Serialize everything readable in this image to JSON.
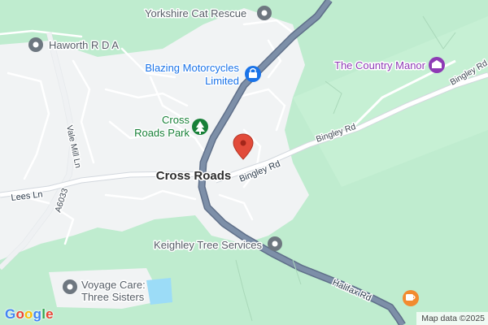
{
  "map": {
    "place_label": "Cross Roads",
    "attribution": "Map data ©2025",
    "logo": "Google",
    "logo_colors": [
      "#4285F4",
      "#EA4335",
      "#FBBC05",
      "#4285F4",
      "#34A853",
      "#EA4335"
    ],
    "colors": {
      "green_area": "#bfeccf",
      "urban_area": "#f1f3f4",
      "main_road": "#7889a4",
      "main_road_outline": "#5f6f89",
      "minor_road": "#ffffff",
      "water": "#9cdcf7",
      "marker": "#e24b3a",
      "poi_gray": "#6e7780",
      "poi_blue": "#1a73e8",
      "poi_green": "#188038",
      "poi_purple": "#8e3bb5",
      "poi_orange": "#f28b2f"
    },
    "pois": [
      {
        "name": "Yorkshire Cat Rescue",
        "icon": "pin-gray-icon",
        "category": "generic"
      },
      {
        "name": "Haworth R D A",
        "icon": "pin-gray-icon",
        "category": "generic"
      },
      {
        "name": "Blazing Motorcycles Limited",
        "icon": "shopping-bag-icon",
        "category": "shopping"
      },
      {
        "name": "Cross Roads Park",
        "icon": "tree-icon",
        "category": "park"
      },
      {
        "name": "The Country Manor",
        "icon": "lodging-icon",
        "category": "lodging"
      },
      {
        "name": "Keighley Tree Services",
        "icon": "pin-gray-icon",
        "category": "generic"
      },
      {
        "name": "Voyage Care: Three Sisters",
        "icon": "pin-gray-icon",
        "category": "generic"
      },
      {
        "name": "",
        "icon": "cafe-icon",
        "category": "cafe"
      }
    ],
    "roads": {
      "lees_ln": "Lees Ln",
      "vale_mill_ln": "Vale Mill Ln",
      "a6033": "A6033",
      "bingley_rd_1": "Bingley Rd",
      "bingley_rd_2": "Bingley Rd",
      "bingley_rd_3": "Bingley Rd",
      "halifax_rd": "Halifax Rd"
    }
  }
}
